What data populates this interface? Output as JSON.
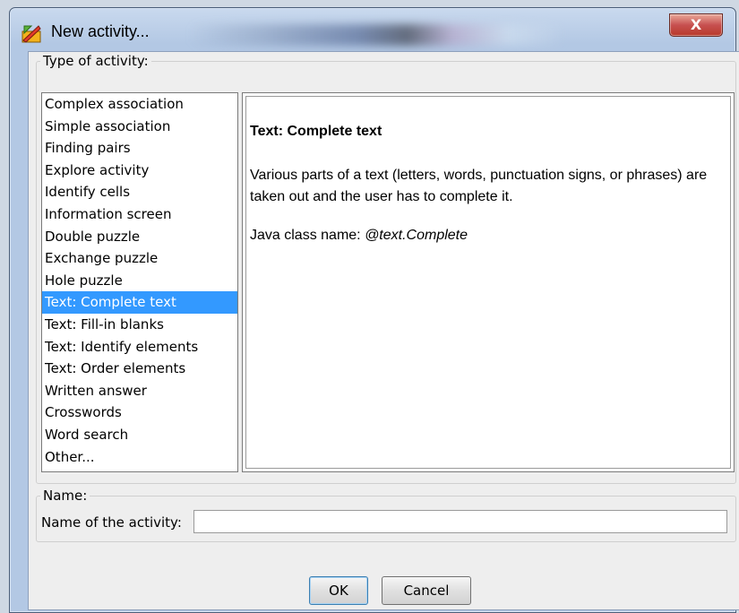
{
  "window": {
    "title": "New activity...",
    "close_label": "X",
    "accent": "#3399ff"
  },
  "type_group": {
    "legend": "Type of activity:",
    "items": [
      {
        "label": "Complex association"
      },
      {
        "label": "Simple association"
      },
      {
        "label": "Finding pairs"
      },
      {
        "label": "Explore activity"
      },
      {
        "label": "Identify cells"
      },
      {
        "label": "Information screen"
      },
      {
        "label": "Double puzzle"
      },
      {
        "label": "Exchange puzzle"
      },
      {
        "label": "Hole puzzle"
      },
      {
        "label": "Text: Complete text"
      },
      {
        "label": "Text: Fill-in blanks"
      },
      {
        "label": "Text: Identify elements"
      },
      {
        "label": "Text: Order elements"
      },
      {
        "label": "Written answer"
      },
      {
        "label": "Crosswords"
      },
      {
        "label": "Word search"
      },
      {
        "label": "Other..."
      }
    ],
    "selected_index": 9
  },
  "description": {
    "title": "Text: Complete text",
    "text": "Various parts of a text (letters, words, punctuation signs, or phrases) are taken out and the user has to complete it.",
    "class_prefix": "Java class name: ",
    "class_name": "@text.Complete"
  },
  "name_group": {
    "legend": "Name:",
    "field_label": "Name of the activity:",
    "value": ""
  },
  "buttons": {
    "ok": "OK",
    "cancel": "Cancel"
  }
}
